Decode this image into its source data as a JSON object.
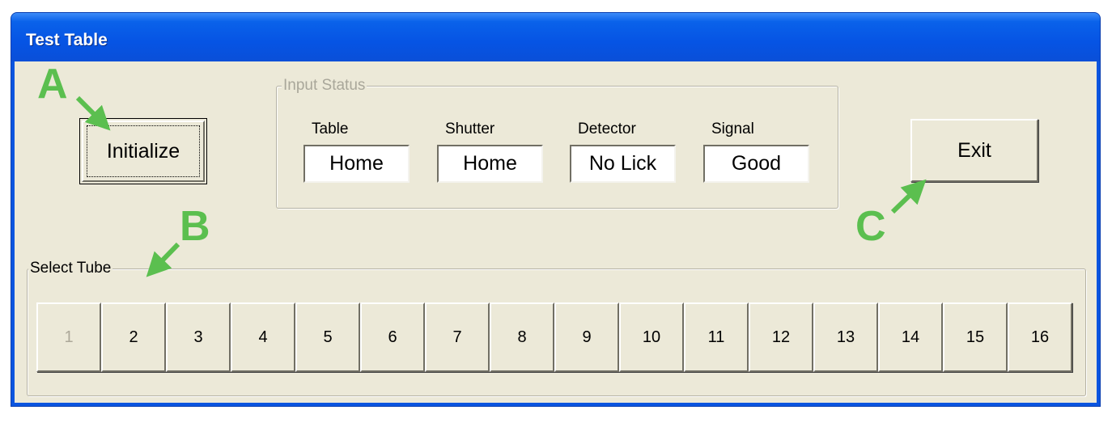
{
  "window": {
    "title": "Test Table"
  },
  "buttons": {
    "initialize": "Initialize",
    "exit": "Exit"
  },
  "input_status": {
    "legend": "Input Status",
    "fields": [
      {
        "label": "Table",
        "value": "Home"
      },
      {
        "label": "Shutter",
        "value": "Home"
      },
      {
        "label": "Detector",
        "value": "No Lick"
      },
      {
        "label": "Signal",
        "value": "Good"
      }
    ]
  },
  "select_tube": {
    "legend": "Select Tube",
    "tubes": [
      "1",
      "2",
      "3",
      "4",
      "5",
      "6",
      "7",
      "8",
      "9",
      "10",
      "11",
      "12",
      "13",
      "14",
      "15",
      "16"
    ],
    "disabled": [
      "1"
    ]
  },
  "annotations": {
    "a": "A",
    "b": "B",
    "c": "C",
    "color": "#5bbf4f"
  },
  "colors": {
    "titlebar": "#0654e4",
    "face": "#ece9d8",
    "disabled_text": "#aca899"
  }
}
